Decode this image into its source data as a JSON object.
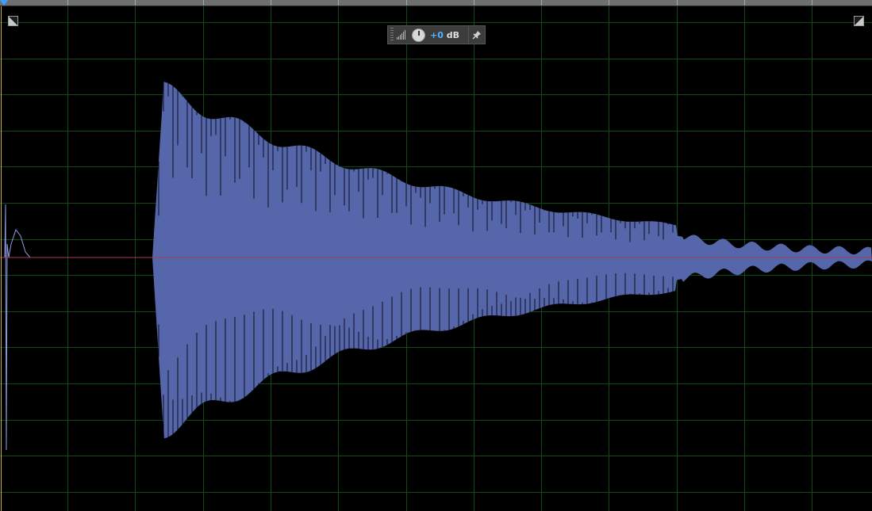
{
  "hud": {
    "gain_value": "+0",
    "gain_unit": "dB",
    "icons": {
      "grip": "drag-grip-icon",
      "meter": "level-meter-icon",
      "knob": "volume-knob-icon",
      "pin": "pin-icon"
    }
  },
  "controls": {
    "zoom_left_icon": "zoom-corner-icon",
    "zoom_right_icon": "zoom-corner-icon"
  },
  "colors": {
    "background": "#000000",
    "grid": "#0e4a12",
    "waveform": "#5566aa",
    "center_line": "#a83a55",
    "envelope": "#8f9be0",
    "playhead": "#c9b43a",
    "hud_accent": "#4fb3ff"
  }
}
